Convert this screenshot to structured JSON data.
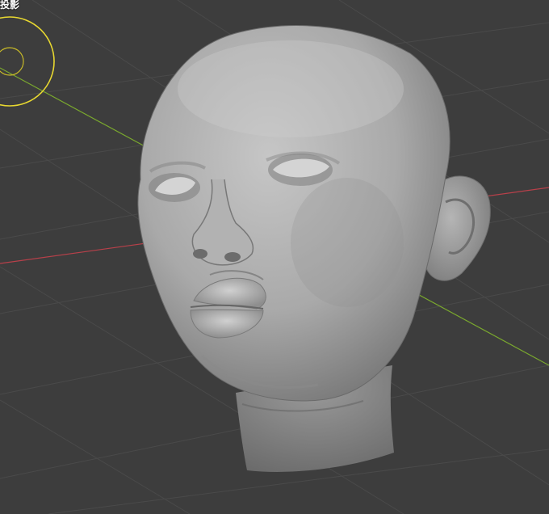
{
  "viewport": {
    "label": "投影",
    "background": "#3d3d3d",
    "grid_color": "#4a4a4a",
    "x_axis_color": "#b8404a",
    "y_axis_color": "#7aa82e",
    "light_gizmo_color": "#e8d830"
  },
  "scene": {
    "object_icon": "sculpted-head-mesh",
    "gizmo_icon": "light-gizmo-icon"
  }
}
